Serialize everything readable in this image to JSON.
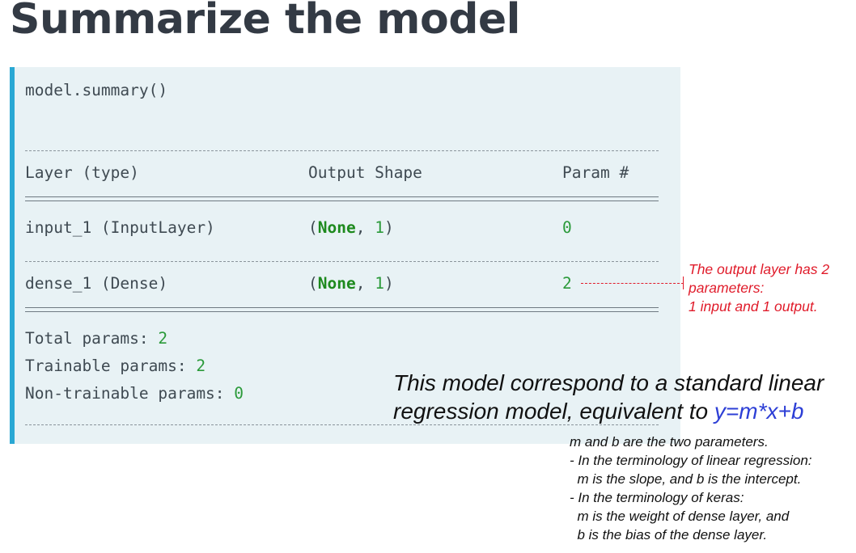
{
  "title": "Summarize the model",
  "code": {
    "call": "model.summary()",
    "header": {
      "layer": "Layer (type)",
      "shape": "Output Shape",
      "param": "Param #"
    },
    "rows": [
      {
        "layer": "input_1 (InputLayer)",
        "shape_open": "(",
        "shape_none": "None",
        "shape_sep": ", ",
        "shape_dim": "1",
        "shape_close": ")",
        "param": "0"
      },
      {
        "layer": "dense_1 (Dense)",
        "shape_open": "(",
        "shape_none": "None",
        "shape_sep": ", ",
        "shape_dim": "1",
        "shape_close": ")",
        "param": "2"
      }
    ],
    "totals": {
      "total_label": "Total params: ",
      "total_value": "2",
      "trainable_label": "Trainable params: ",
      "trainable_value": "2",
      "nontrainable_label": "Non-trainable params: ",
      "nontrainable_value": "0"
    }
  },
  "annotations": {
    "output_layer": [
      "The output layer has 2",
      "parameters:",
      "1 input and 1 output."
    ],
    "main_line1": "This model correspond to a standard linear",
    "main_line2_prefix": "regression model, equivalent to ",
    "formula": "y=m*x+b",
    "details": [
      "m and b are the two parameters.",
      "- In the terminology of linear regression:",
      "  m is the slope, and b is the intercept.",
      "- In the terminology of keras:",
      "  m is the weight of dense layer, and",
      "  b is the bias of the dense layer."
    ]
  },
  "colors": {
    "accent": "#2aa8d4",
    "code_bg": "#e8f2f5",
    "number": "#2b9a3a",
    "annotation_red": "#e01b2a",
    "formula_blue": "#2d3fd6"
  }
}
